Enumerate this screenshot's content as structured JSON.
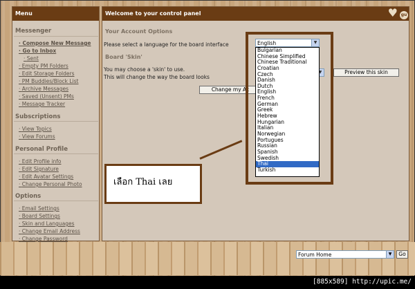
{
  "menu": {
    "title": "Menu",
    "sections": [
      {
        "title": "Messenger",
        "links": [
          "Compose New Message",
          "Go to Inbox",
          "Sent",
          "Empty PM Folders",
          "Edit Storage Folders",
          "PM Buddies/Block List",
          "Archive Messages",
          "Saved (Unsent) PMs",
          "Message Tracker"
        ]
      },
      {
        "title": "Subscriptions",
        "links": [
          "View Topics",
          "View Forums"
        ]
      },
      {
        "title": "Personal Profile",
        "links": [
          "Edit Profile info",
          "Edit Signature",
          "Edit Avatar Settings",
          "Change Personal Photo"
        ]
      },
      {
        "title": "Options",
        "links": [
          "Email Settings",
          "Board Settings",
          "Skin and Languages",
          "Change Email Address",
          "Change Password"
        ]
      }
    ]
  },
  "main": {
    "title": "Welcome to your control panel",
    "logo_text": "gu",
    "account_options_label": "Your Account Options",
    "language_prompt": "Please select a language for the board interface",
    "language_selected": "English",
    "skin_label": "Board 'Skin'",
    "skin_text_1": "You may choose a 'skin' to use.",
    "skin_text_2": "This will change the way the board looks",
    "change_button": "Change my Ac",
    "preview_button": "Preview this skin"
  },
  "language_options": [
    "Bulgarian",
    "Chinese Simplified",
    "Chinese Traditional",
    "Croatian",
    "Czech",
    "Danish",
    "Dutch",
    "English",
    "French",
    "German",
    "Greek",
    "Hebrew",
    "Hungarian",
    "Italian",
    "Norwegian",
    "Portugues",
    "Russian",
    "Spanish",
    "Swedish",
    "Thai",
    "Turkish"
  ],
  "highlighted_option": "Thai",
  "callout_text": "เลือก Thai เลย",
  "forum_jump": {
    "selected": "Forum Home",
    "go_label": "Go"
  },
  "footer_text": "[885x589] http://upic.me/",
  "colors": {
    "header_brown": "#6a3c14",
    "panel": "#d4c8ba",
    "selection": "#316ac5"
  }
}
